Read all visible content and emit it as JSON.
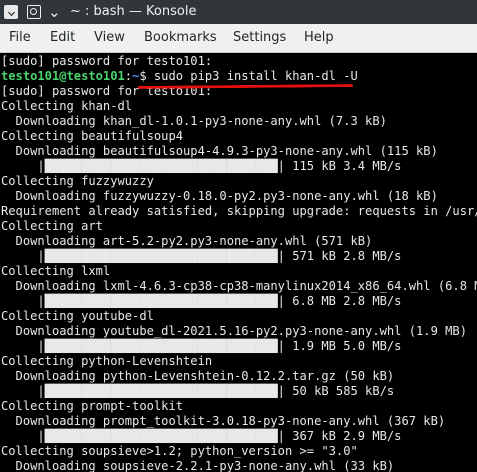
{
  "window": {
    "title": "~ : bash — Konsole"
  },
  "menu": [
    "File",
    "Edit",
    "View",
    "Bookmarks",
    "Settings",
    "Help"
  ],
  "terminal": {
    "line1": "[sudo] password for testo101:",
    "prompt": {
      "user_host": "testo101@testo101",
      "sep": ":",
      "path": "~",
      "dollar": "$ ",
      "command": "sudo pip3 install khan-dl -U"
    },
    "lines": [
      "[sudo] password for testo101:",
      "Collecting khan-dl",
      "  Downloading khan_dl-1.0.1-py3-none-any.whl (7.3 kB)",
      "Collecting beautifulsoup4",
      "  Downloading beautifulsoup4-4.9.3-py3-none-any.whl (115 kB)",
      "     |████████████████████████████████| 115 kB 3.4 MB/s",
      "Collecting fuzzywuzzy",
      "  Downloading fuzzywuzzy-0.18.0-py2.py3-none-any.whl (18 kB)",
      "Requirement already satisfied, skipping upgrade: requests in /usr/li",
      "Collecting art",
      "  Downloading art-5.2-py2.py3-none-any.whl (571 kB)",
      "     |████████████████████████████████| 571 kB 2.8 MB/s",
      "Collecting lxml",
      "  Downloading lxml-4.6.3-cp38-cp38-manylinux2014_x86_64.whl (6.8 MB)",
      "     |████████████████████████████████| 6.8 MB 2.8 MB/s",
      "Collecting youtube-dl",
      "  Downloading youtube_dl-2021.5.16-py2.py3-none-any.whl (1.9 MB)",
      "     |████████████████████████████████| 1.9 MB 5.0 MB/s",
      "Collecting python-Levenshtein",
      "  Downloading python-Levenshtein-0.12.2.tar.gz (50 kB)",
      "     |████████████████████████████████| 50 kB 585 kB/s",
      "Collecting prompt-toolkit",
      "  Downloading prompt_toolkit-3.0.18-py3-none-any.whl (367 kB)",
      "     |████████████████████████████████| 367 kB 2.9 MB/s",
      "Collecting soupsieve>1.2; python_version >= \"3.0\"",
      "  Downloading soupsieve-2.2.1-py3-none-any.whl (33 kB)"
    ]
  },
  "progress": [
    {
      "status": "115 kB 3.4 MB/s",
      "fraction": 1.0
    },
    {
      "status": "571 kB 2.8 MB/s",
      "fraction": 1.0
    },
    {
      "status": "6.8 MB 2.8 MB/s",
      "fraction": 1.0
    },
    {
      "status": "1.9 MB 5.0 MB/s",
      "fraction": 1.0
    },
    {
      "status": "50 kB 585 kB/s",
      "fraction": 1.0
    },
    {
      "status": "367 kB 2.9 MB/s",
      "fraction": 1.0
    }
  ],
  "colors": {
    "prompt_user": "#4ad36e",
    "prompt_path": "#3b8eea",
    "annotation_underline": "#e5100d",
    "terminal_bg": "#000000",
    "terminal_fg": "#e8e8e8"
  }
}
